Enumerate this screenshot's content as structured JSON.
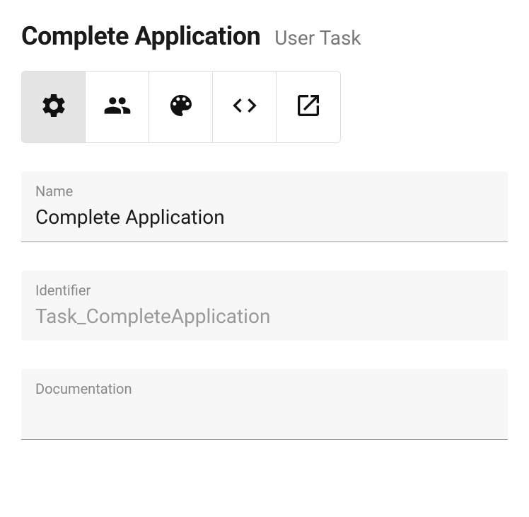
{
  "header": {
    "title": "Complete Application",
    "subtitle": "User Task"
  },
  "tabs": [
    {
      "id": "general",
      "icon": "gear",
      "active": true
    },
    {
      "id": "people",
      "icon": "people",
      "active": false
    },
    {
      "id": "palette",
      "icon": "palette",
      "active": false
    },
    {
      "id": "code",
      "icon": "code",
      "active": false
    },
    {
      "id": "open",
      "icon": "open-in-new",
      "active": false
    }
  ],
  "fields": {
    "name": {
      "label": "Name",
      "value": "Complete Application"
    },
    "identifier": {
      "label": "Identifier",
      "value": "Task_CompleteApplication"
    },
    "documentation": {
      "label": "Documentation",
      "value": ""
    }
  }
}
